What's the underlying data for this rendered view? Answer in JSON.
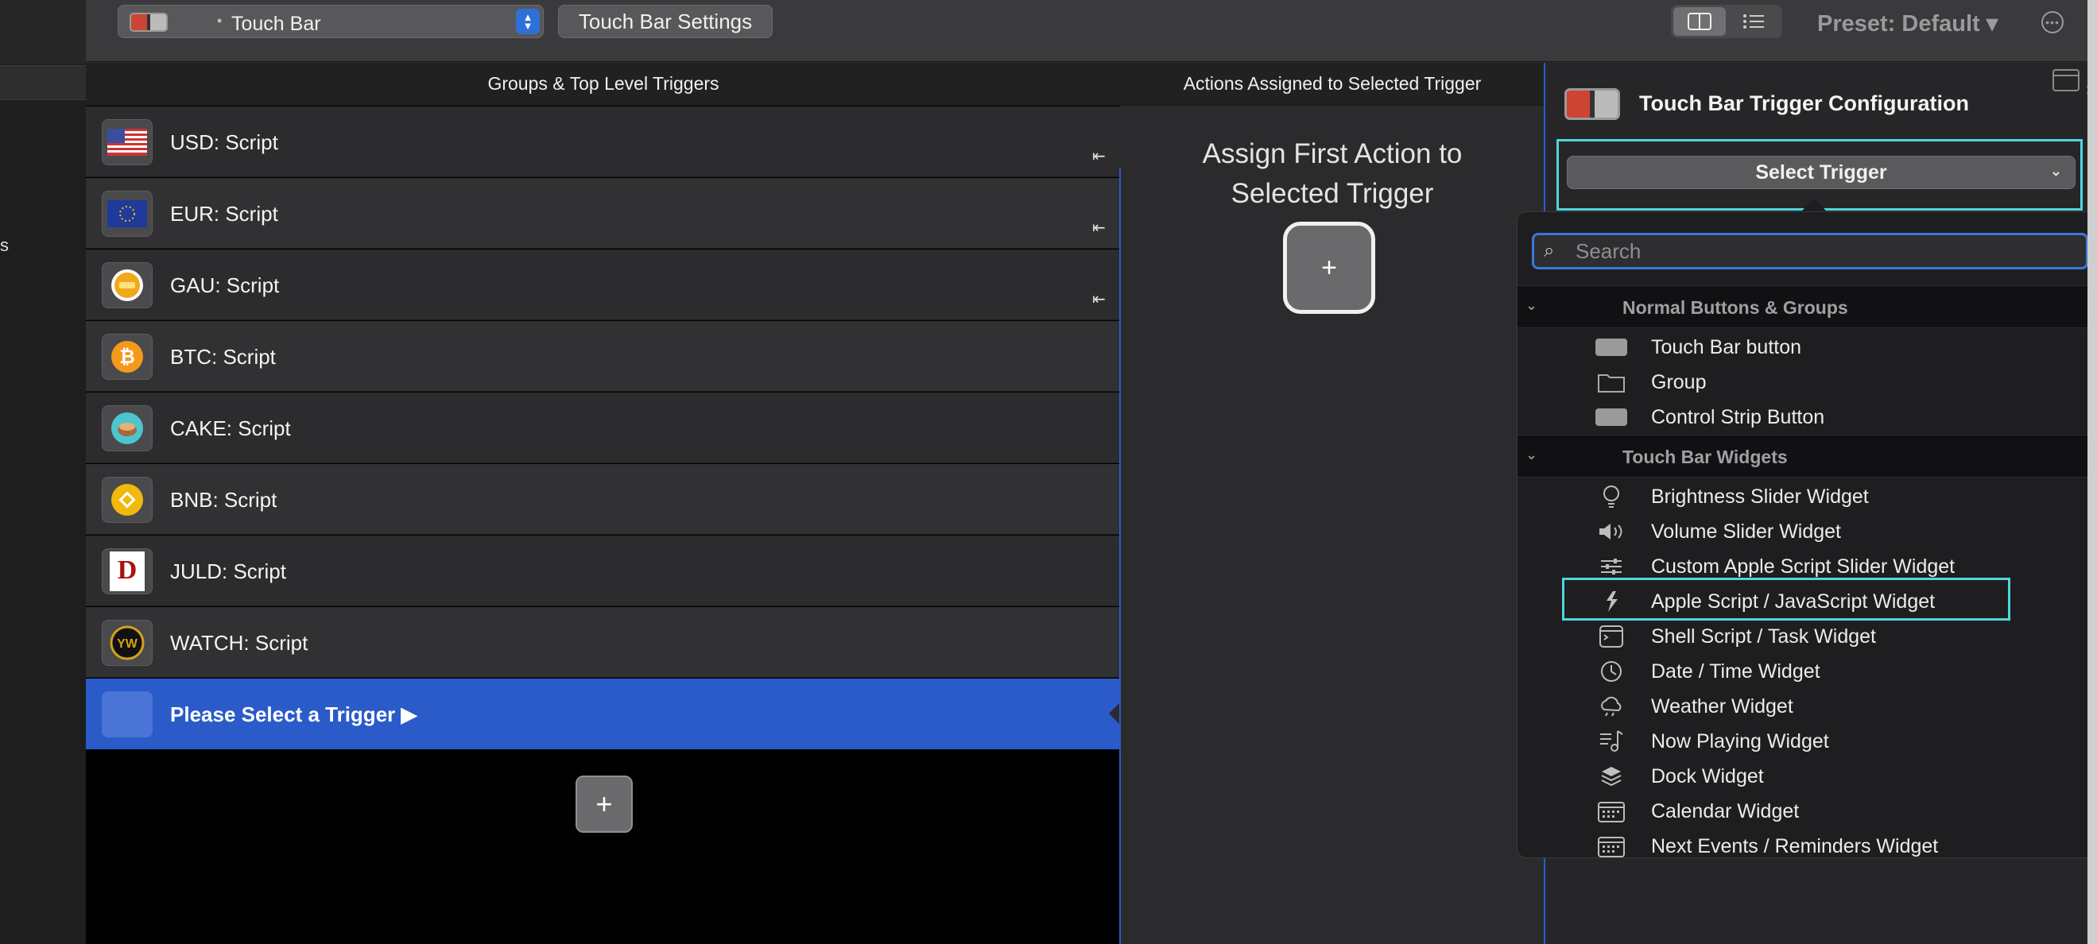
{
  "toolbar": {
    "device_select": "Touch Bar",
    "settings_button": "Touch Bar Settings",
    "preset": "Preset: Default ▾"
  },
  "left_strip": {
    "fragment": "s"
  },
  "groups_panel": {
    "header": "Groups & Top Level Triggers",
    "triggers": [
      {
        "name": "USD: Script",
        "icon": "us-flag-icon",
        "pinned": true
      },
      {
        "name": "EUR: Script",
        "icon": "eu-flag-icon",
        "pinned": true
      },
      {
        "name": "GAU: Script",
        "icon": "gold-icon",
        "pinned": true
      },
      {
        "name": "BTC: Script",
        "icon": "bitcoin-icon",
        "pinned": false
      },
      {
        "name": "CAKE: Script",
        "icon": "cake-icon",
        "pinned": false
      },
      {
        "name": "BNB: Script",
        "icon": "bnb-icon",
        "pinned": false
      },
      {
        "name": "JULD: Script",
        "icon": "juld-icon",
        "pinned": false
      },
      {
        "name": "WATCH: Script",
        "icon": "watch-icon",
        "pinned": false
      }
    ],
    "select_row": "Please Select a Trigger ▶",
    "add_button": "+"
  },
  "actions_panel": {
    "header": "Actions Assigned to Selected Trigger",
    "assign_line1": "Assign First Action to",
    "assign_line2": "Selected Trigger",
    "add_button": "+"
  },
  "config_panel": {
    "title": "Touch Bar Trigger Configuration",
    "select_trigger": "Select Trigger"
  },
  "dropdown": {
    "search_placeholder": "Search",
    "groups": [
      {
        "label": "Normal Buttons & Groups",
        "items": [
          {
            "label": "Touch Bar button",
            "icon": "button-icon"
          },
          {
            "label": "Group",
            "icon": "folder-icon"
          },
          {
            "label": "Control Strip Button",
            "icon": "button-icon"
          }
        ]
      },
      {
        "label": "Touch Bar Widgets",
        "items": [
          {
            "label": "Brightness Slider Widget",
            "icon": "lightbulb-icon"
          },
          {
            "label": "Volume Slider Widget",
            "icon": "speaker-icon"
          },
          {
            "label": "Custom Apple Script Slider Widget",
            "icon": "sliders-icon"
          },
          {
            "label": "Apple Script / JavaScript Widget",
            "icon": "script-icon",
            "highlighted": true
          },
          {
            "label": "Shell Script / Task Widget",
            "icon": "terminal-icon"
          },
          {
            "label": "Date / Time Widget",
            "icon": "clock-icon"
          },
          {
            "label": "Weather Widget",
            "icon": "cloud-icon"
          },
          {
            "label": "Now Playing Widget",
            "icon": "music-icon"
          },
          {
            "label": "Dock Widget",
            "icon": "layers-icon"
          },
          {
            "label": "Calendar Widget",
            "icon": "calendar-icon"
          },
          {
            "label": "Next Events / Reminders Widget",
            "icon": "calendar-icon"
          }
        ]
      }
    ]
  },
  "colors": {
    "selection_blue": "#2a5bc8",
    "highlight_cyan": "#4fd6dc",
    "panel_bg": "#2b2b2d"
  }
}
